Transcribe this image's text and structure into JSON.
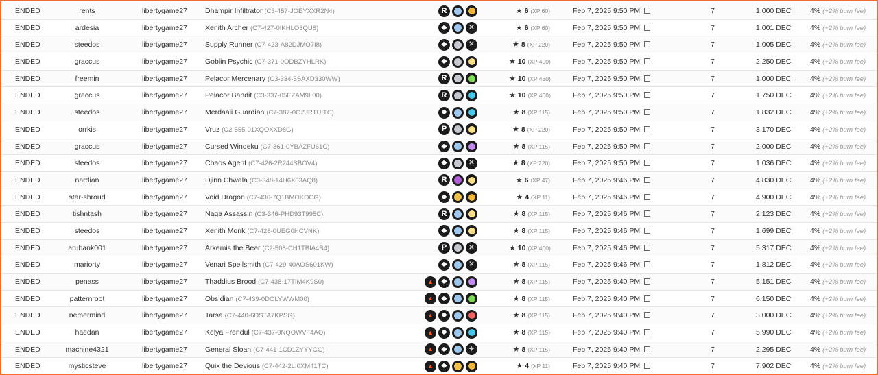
{
  "colors": {
    "border": "#f26b2a",
    "rarity_icon_bg": "#1c1c1c",
    "foil_regular": "#9ec7ee",
    "foil_gold": "#f2c04f",
    "foil_silver": "#c5c9cf",
    "foil_purple": "#b25cd9",
    "element_fire": "#f06262",
    "element_earth": "#7ed957",
    "element_water": "#46c7e8",
    "element_life": "#ffe08a",
    "element_dragon": "#f2b83a",
    "element_neutral": "#9a9a9a",
    "element_death": "#c48cf0"
  },
  "rows": [
    {
      "status": "ENDED",
      "seller": "rents",
      "buyer": "libertygame27",
      "card_name": "Dhampir Infiltrator",
      "card_id": "(C3-457-JOEYXXR2N4)",
      "icons": [
        "rarity-r",
        "foil-regular",
        "element-dragon"
      ],
      "level": "6",
      "xp": "(XP 60)",
      "date": "Feb 7, 2025 9:50 PM",
      "qty": "7",
      "price": "1.000 DEC",
      "fee": "4%",
      "fee_note": "(+2% burn fee)"
    },
    {
      "status": "ENDED",
      "seller": "ardesia",
      "buyer": "libertygame27",
      "card_name": "Xenith Archer",
      "card_id": "(C7-427-0IKHLO3QU8)",
      "icons": [
        "rarity-diamond",
        "foil-regular",
        "element-neutral"
      ],
      "level": "6",
      "xp": "(XP 60)",
      "date": "Feb 7, 2025 9:50 PM",
      "qty": "7",
      "price": "1.001 DEC",
      "fee": "4%",
      "fee_note": "(+2% burn fee)"
    },
    {
      "status": "ENDED",
      "seller": "steedos",
      "buyer": "libertygame27",
      "card_name": "Supply Runner",
      "card_id": "(C7-423-A82DJMO7I8)",
      "icons": [
        "rarity-diamond",
        "foil-silver",
        "element-neutral"
      ],
      "level": "8",
      "xp": "(XP 220)",
      "date": "Feb 7, 2025 9:50 PM",
      "qty": "7",
      "price": "1.005 DEC",
      "fee": "4%",
      "fee_note": "(+2% burn fee)"
    },
    {
      "status": "ENDED",
      "seller": "graccus",
      "buyer": "libertygame27",
      "card_name": "Goblin Psychic",
      "card_id": "(C7-371-0ODBZYHLRK)",
      "icons": [
        "rarity-diamond",
        "foil-silver",
        "element-life"
      ],
      "level": "10",
      "xp": "(XP 400)",
      "date": "Feb 7, 2025 9:50 PM",
      "qty": "7",
      "price": "2.250 DEC",
      "fee": "4%",
      "fee_note": "(+2% burn fee)"
    },
    {
      "status": "ENDED",
      "seller": "freemin",
      "buyer": "libertygame27",
      "card_name": "Pelacor Mercenary",
      "card_id": "(C3-334-5SAXD330WW)",
      "icons": [
        "rarity-r",
        "foil-silver",
        "element-earth"
      ],
      "level": "10",
      "xp": "(XP 430)",
      "date": "Feb 7, 2025 9:50 PM",
      "qty": "7",
      "price": "1.000 DEC",
      "fee": "4%",
      "fee_note": "(+2% burn fee)"
    },
    {
      "status": "ENDED",
      "seller": "graccus",
      "buyer": "libertygame27",
      "card_name": "Pelacor Bandit",
      "card_id": "(C3-337-05EZAM9L00)",
      "icons": [
        "rarity-r",
        "foil-silver",
        "element-water"
      ],
      "level": "10",
      "xp": "(XP 400)",
      "date": "Feb 7, 2025 9:50 PM",
      "qty": "7",
      "price": "1.750 DEC",
      "fee": "4%",
      "fee_note": "(+2% burn fee)"
    },
    {
      "status": "ENDED",
      "seller": "steedos",
      "buyer": "libertygame27",
      "card_name": "Merdaali Guardian",
      "card_id": "(C7-387-0OZJRTUITC)",
      "icons": [
        "rarity-diamond",
        "foil-regular",
        "element-water"
      ],
      "level": "8",
      "xp": "(XP 115)",
      "date": "Feb 7, 2025 9:50 PM",
      "qty": "7",
      "price": "1.832 DEC",
      "fee": "4%",
      "fee_note": "(+2% burn fee)"
    },
    {
      "status": "ENDED",
      "seller": "orrkis",
      "buyer": "libertygame27",
      "card_name": "Vruz",
      "card_id": "(C2-555-01XQOXXD8G)",
      "icons": [
        "rarity-p",
        "foil-silver",
        "element-life"
      ],
      "level": "8",
      "xp": "(XP 220)",
      "date": "Feb 7, 2025 9:50 PM",
      "qty": "7",
      "price": "3.170 DEC",
      "fee": "4%",
      "fee_note": "(+2% burn fee)"
    },
    {
      "status": "ENDED",
      "seller": "graccus",
      "buyer": "libertygame27",
      "card_name": "Cursed Windeku",
      "card_id": "(C7-361-0YBAZFU61C)",
      "icons": [
        "rarity-diamond",
        "foil-regular",
        "element-death"
      ],
      "level": "8",
      "xp": "(XP 115)",
      "date": "Feb 7, 2025 9:50 PM",
      "qty": "7",
      "price": "2.000 DEC",
      "fee": "4%",
      "fee_note": "(+2% burn fee)"
    },
    {
      "status": "ENDED",
      "seller": "steedos",
      "buyer": "libertygame27",
      "card_name": "Chaos Agent",
      "card_id": "(C7-426-2R244SBOV4)",
      "icons": [
        "rarity-diamond",
        "foil-silver",
        "element-neutral"
      ],
      "level": "8",
      "xp": "(XP 220)",
      "date": "Feb 7, 2025 9:50 PM",
      "qty": "7",
      "price": "1.036 DEC",
      "fee": "4%",
      "fee_note": "(+2% burn fee)"
    },
    {
      "status": "ENDED",
      "seller": "nardian",
      "buyer": "libertygame27",
      "card_name": "Djinn Chwala",
      "card_id": "(C3-348-14H6X03AQ8)",
      "icons": [
        "rarity-r",
        "foil-purple",
        "element-life"
      ],
      "level": "6",
      "xp": "(XP 47)",
      "date": "Feb 7, 2025 9:46 PM",
      "qty": "7",
      "price": "4.830 DEC",
      "fee": "4%",
      "fee_note": "(+2% burn fee)"
    },
    {
      "status": "ENDED",
      "seller": "star-shroud",
      "buyer": "libertygame27",
      "card_name": "Void Dragon",
      "card_id": "(C7-436-7Q1BMOKOCG)",
      "icons": [
        "rarity-diamond",
        "foil-gold",
        "element-dragon"
      ],
      "level": "4",
      "xp": "(XP 11)",
      "date": "Feb 7, 2025 9:46 PM",
      "qty": "7",
      "price": "4.900 DEC",
      "fee": "4%",
      "fee_note": "(+2% burn fee)"
    },
    {
      "status": "ENDED",
      "seller": "tishntash",
      "buyer": "libertygame27",
      "card_name": "Naga Assassin",
      "card_id": "(C3-346-PHD93T995C)",
      "icons": [
        "rarity-r",
        "foil-regular",
        "element-life"
      ],
      "level": "8",
      "xp": "(XP 115)",
      "date": "Feb 7, 2025 9:46 PM",
      "qty": "7",
      "price": "2.123 DEC",
      "fee": "4%",
      "fee_note": "(+2% burn fee)"
    },
    {
      "status": "ENDED",
      "seller": "steedos",
      "buyer": "libertygame27",
      "card_name": "Xenith Monk",
      "card_id": "(C7-428-0UEG0HCVNK)",
      "icons": [
        "rarity-diamond",
        "foil-regular",
        "element-life"
      ],
      "level": "8",
      "xp": "(XP 115)",
      "date": "Feb 7, 2025 9:46 PM",
      "qty": "7",
      "price": "1.699 DEC",
      "fee": "4%",
      "fee_note": "(+2% burn fee)"
    },
    {
      "status": "ENDED",
      "seller": "arubank001",
      "buyer": "libertygame27",
      "card_name": "Arkemis the Bear",
      "card_id": "(C2-508-CH1TBIA4B4)",
      "icons": [
        "rarity-p",
        "foil-silver",
        "element-neutral"
      ],
      "level": "10",
      "xp": "(XP 400)",
      "date": "Feb 7, 2025 9:46 PM",
      "qty": "7",
      "price": "5.317 DEC",
      "fee": "4%",
      "fee_note": "(+2% burn fee)"
    },
    {
      "status": "ENDED",
      "seller": "mariorty",
      "buyer": "libertygame27",
      "card_name": "Venari Spellsmith",
      "card_id": "(C7-429-40AOS601KW)",
      "icons": [
        "rarity-diamond",
        "foil-regular",
        "element-neutral"
      ],
      "level": "8",
      "xp": "(XP 115)",
      "date": "Feb 7, 2025 9:46 PM",
      "qty": "7",
      "price": "1.812 DEC",
      "fee": "4%",
      "fee_note": "(+2% burn fee)"
    },
    {
      "status": "ENDED",
      "seller": "penass",
      "buyer": "libertygame27",
      "card_name": "Thaddius Brood",
      "card_id": "(C7-438-17TIM4K9S0)",
      "icons": [
        "set-rebellion",
        "rarity-diamond",
        "foil-regular",
        "element-death"
      ],
      "level": "8",
      "xp": "(XP 115)",
      "date": "Feb 7, 2025 9:40 PM",
      "qty": "7",
      "price": "5.151 DEC",
      "fee": "4%",
      "fee_note": "(+2% burn fee)"
    },
    {
      "status": "ENDED",
      "seller": "patternroot",
      "buyer": "libertygame27",
      "card_name": "Obsidian",
      "card_id": "(C7-439-0DOLYWWM00)",
      "icons": [
        "set-rebellion",
        "rarity-diamond",
        "foil-regular",
        "element-earth"
      ],
      "level": "8",
      "xp": "(XP 115)",
      "date": "Feb 7, 2025 9:40 PM",
      "qty": "7",
      "price": "6.150 DEC",
      "fee": "4%",
      "fee_note": "(+2% burn fee)"
    },
    {
      "status": "ENDED",
      "seller": "nemermind",
      "buyer": "libertygame27",
      "card_name": "Tarsa",
      "card_id": "(C7-440-6DSTA7KPSG)",
      "icons": [
        "set-rebellion",
        "rarity-diamond",
        "foil-regular",
        "element-fire"
      ],
      "level": "8",
      "xp": "(XP 115)",
      "date": "Feb 7, 2025 9:40 PM",
      "qty": "7",
      "price": "3.000 DEC",
      "fee": "4%",
      "fee_note": "(+2% burn fee)"
    },
    {
      "status": "ENDED",
      "seller": "haedan",
      "buyer": "libertygame27",
      "card_name": "Kelya Frendul",
      "card_id": "(C7-437-0NQOWVF4AO)",
      "icons": [
        "set-rebellion",
        "rarity-diamond",
        "foil-regular",
        "element-water"
      ],
      "level": "8",
      "xp": "(XP 115)",
      "date": "Feb 7, 2025 9:40 PM",
      "qty": "7",
      "price": "5.990 DEC",
      "fee": "4%",
      "fee_note": "(+2% burn fee)"
    },
    {
      "status": "ENDED",
      "seller": "machine4321",
      "buyer": "libertygame27",
      "card_name": "General Sloan",
      "card_id": "(C7-441-1CD1ZYYYGG)",
      "icons": [
        "set-rebellion",
        "rarity-diamond",
        "foil-regular",
        "element-neutral-star"
      ],
      "level": "8",
      "xp": "(XP 115)",
      "date": "Feb 7, 2025 9:40 PM",
      "qty": "7",
      "price": "2.295 DEC",
      "fee": "4%",
      "fee_note": "(+2% burn fee)"
    },
    {
      "status": "ENDED",
      "seller": "mysticsteve",
      "buyer": "libertygame27",
      "card_name": "Quix the Devious",
      "card_id": "(C7-442-2LI0XM41TC)",
      "icons": [
        "set-rebellion",
        "rarity-diamond",
        "foil-gold",
        "element-dragon"
      ],
      "level": "4",
      "xp": "(XP 11)",
      "date": "Feb 7, 2025 9:40 PM",
      "qty": "7",
      "price": "7.902 DEC",
      "fee": "4%",
      "fee_note": "(+2% burn fee)"
    }
  ]
}
